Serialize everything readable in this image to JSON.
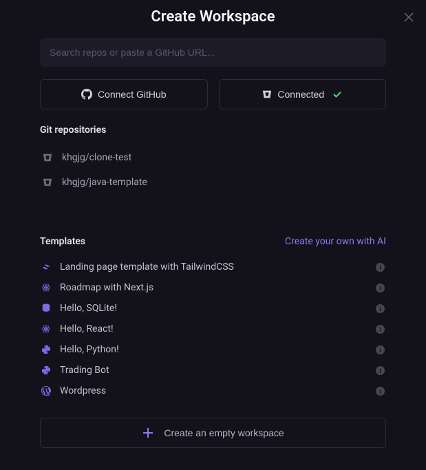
{
  "title": "Create Workspace",
  "search": {
    "placeholder": "Search repos or paste a GitHub URL..."
  },
  "buttons": {
    "connect_github": "Connect GitHub",
    "connected": "Connected"
  },
  "repos": {
    "heading": "Git repositories",
    "items": [
      {
        "name": "khgjg/clone-test"
      },
      {
        "name": "khgjg/java-template"
      }
    ]
  },
  "templates": {
    "heading": "Templates",
    "ai_link": "Create your own with AI",
    "items": [
      {
        "icon": "tailwind",
        "name": "Landing page template with TailwindCSS"
      },
      {
        "icon": "react",
        "name": "Roadmap with Next.js"
      },
      {
        "icon": "database",
        "name": "Hello, SQLite!"
      },
      {
        "icon": "react",
        "name": "Hello, React!"
      },
      {
        "icon": "python",
        "name": "Hello, Python!"
      },
      {
        "icon": "python",
        "name": "Trading Bot"
      },
      {
        "icon": "wordpress",
        "name": "Wordpress"
      }
    ]
  },
  "empty_workspace": "Create an empty workspace"
}
